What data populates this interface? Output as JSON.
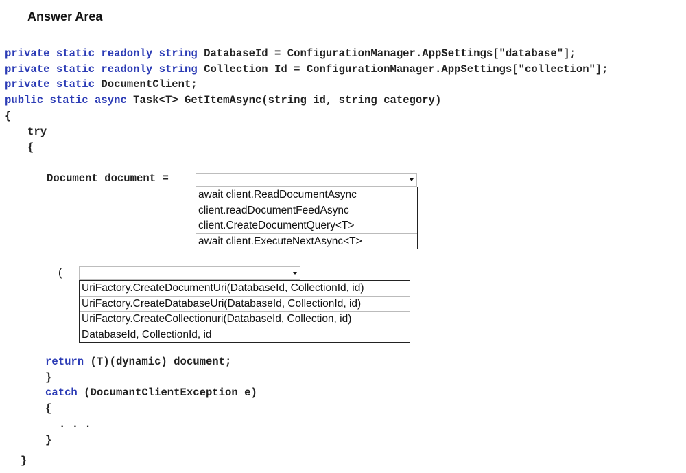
{
  "title": "Answer Area",
  "code": {
    "line1": {
      "kw": "private static readonly string",
      "rest": " DatabaseId = ConfigurationManager.AppSettings[\"database\"];"
    },
    "line2": {
      "kw": "private static readonly string",
      "rest": " Collection Id = ConfigurationManager.AppSettings[\"collection\"];"
    },
    "line3": {
      "kw": "private static",
      "rest": " DocumentClient;"
    },
    "line4": {
      "kw": "public static async",
      "rest": " Task<T> GetItemAsync(string id, string category)"
    },
    "open_brace": "{",
    "try": "try",
    "try_open": "{",
    "assign": "Document document =",
    "paren_open": "(",
    "return_kw": "return",
    "return_rest": " (T)(dynamic) document;",
    "try_close": "}",
    "catch_kw": "catch",
    "catch_rest": " (DocumantClientException e)",
    "catch_open": "{",
    "ellipsis": ". . .",
    "catch_close": "}",
    "close_brace": "}"
  },
  "dropdown1": {
    "selected": "",
    "options": [
      "await client.ReadDocumentAsync",
      "client.readDocumentFeedAsync",
      "client.CreateDocumentQuery<T>",
      "await client.ExecuteNextAsync<T>"
    ]
  },
  "dropdown2": {
    "selected": "",
    "options": [
      "UriFactory.CreateDocumentUri(DatabaseId, CollectionId, id)",
      "UriFactory.CreateDatabaseUri(DatabaseId, CollectionId, id)",
      "UriFactory.CreateCollectionuri(DatabaseId, Collection, id)",
      "DatabaseId, CollectionId, id"
    ]
  }
}
